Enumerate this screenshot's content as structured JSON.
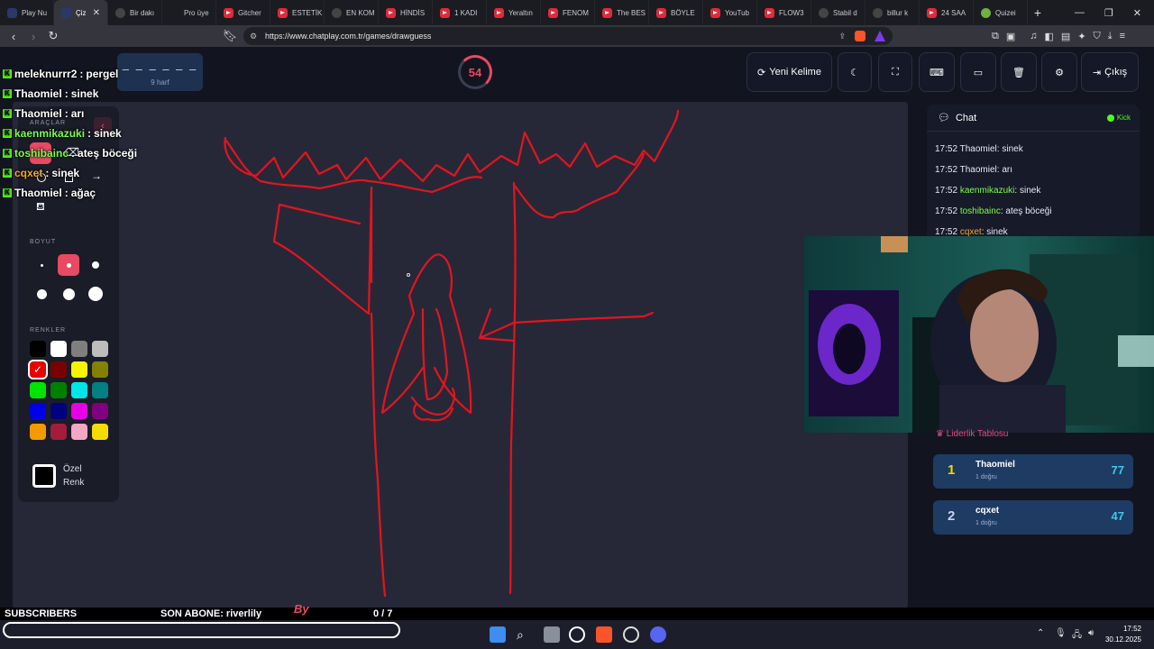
{
  "tabs": [
    {
      "label": "Play Nu"
    },
    {
      "label": "Çiz",
      "active": true
    },
    {
      "label": "Bir dakı"
    },
    {
      "label": "Pro üye"
    },
    {
      "label": "Gitcher"
    },
    {
      "label": "ESTETİK"
    },
    {
      "label": "EN KOM"
    },
    {
      "label": "HİNDİS"
    },
    {
      "label": "1 KADI"
    },
    {
      "label": "Yeraltın"
    },
    {
      "label": "FENOM"
    },
    {
      "label": "The BES"
    },
    {
      "label": "BÖYLE"
    },
    {
      "label": "YouTub"
    },
    {
      "label": "FLOW3"
    },
    {
      "label": "Stabil d"
    },
    {
      "label": "billur k"
    },
    {
      "label": "24 SAA"
    },
    {
      "label": "Quizei"
    }
  ],
  "browser": {
    "url": "https://www.chatplay.com.tr/games/drawguess",
    "new_tab": "+"
  },
  "game": {
    "word_mask": "– – – – – –",
    "word_hint": "9 harf",
    "timer": "54",
    "new_word_label": "Yeni Kelime",
    "exit_label": "Çıkış"
  },
  "tools": {
    "tools_title": "ARAÇLAR",
    "size_title": "BOYUT",
    "colors_title": "RENKLER",
    "custom_label": "Özel Renk",
    "colors": [
      "#000000",
      "#ffffff",
      "#7f7f7f",
      "#bdbdbd",
      "#e60000",
      "#7a0000",
      "#f5f500",
      "#828200",
      "#00e600",
      "#008000",
      "#00e6e6",
      "#008080",
      "#0000e6",
      "#000080",
      "#e600e6",
      "#800080",
      "#f29a00",
      "#a31d3b",
      "#f2a7c3",
      "#f5dc00"
    ],
    "selected_color": "#e60000"
  },
  "stream_chat": [
    {
      "user": "meleknurrr2",
      "text": "pergel",
      "color": "#ffffff"
    },
    {
      "user": "Thaomiel",
      "text": "sinek",
      "color": "#ffffff"
    },
    {
      "user": "Thaomiel",
      "text": "arı",
      "color": "#ffffff"
    },
    {
      "user": "kaenmikazuki",
      "text": "sinek",
      "color": "#7cfc4b"
    },
    {
      "user": "toshibainc",
      "text": "ateş böceği",
      "color": "#7cfc4b"
    },
    {
      "user": "cqxet",
      "text": "sinek",
      "color": "#f5a623"
    },
    {
      "user": "Thaomiel",
      "text": "ağaç",
      "color": "#ffffff"
    }
  ],
  "chat": {
    "title": "Chat",
    "platform": "Kick",
    "messages": [
      {
        "time": "17:52",
        "user": "Thaomiel",
        "text": "sinek",
        "color": "#e8eaf2"
      },
      {
        "time": "17:52",
        "user": "Thaomiel",
        "text": "arı",
        "color": "#e8eaf2"
      },
      {
        "time": "17:52",
        "user": "kaenmikazuki",
        "text": "sinek",
        "color": "#7cfc4b"
      },
      {
        "time": "17:52",
        "user": "toshibainc",
        "text": "ateş böceği",
        "color": "#7cfc4b"
      },
      {
        "time": "17:52",
        "user": "cqxet",
        "text": "sinek",
        "color": "#f5a623"
      }
    ]
  },
  "leaderboard": {
    "title": "Liderlik Tablosu",
    "rows": [
      {
        "rank": "1",
        "name": "Thaomiel",
        "sub": "1 doğru",
        "score": "77",
        "rank_color": "#f5d800"
      },
      {
        "rank": "2",
        "name": "cqxet",
        "sub": "1 doğru",
        "score": "47",
        "rank_color": "#c7d3e6"
      }
    ]
  },
  "footer": {
    "subscribers": "SUBSCRIBERS",
    "last_sub": "SON ABONE: riverlily",
    "goal": "0 / 7",
    "brand": "By"
  },
  "system": {
    "time": "17:52",
    "date": "30.12.2025"
  }
}
